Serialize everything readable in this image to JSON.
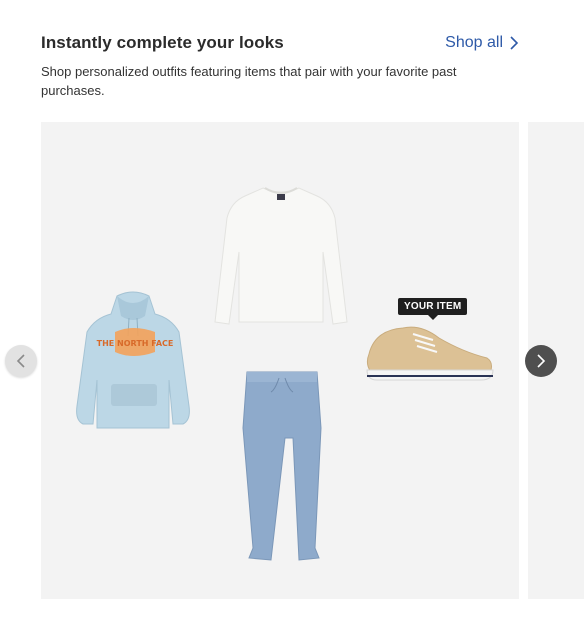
{
  "header": {
    "title": "Instantly complete your looks",
    "shop_all_label": "Shop all",
    "subtitle": "Shop personalized outfits featuring items that pair with your favorite past purchases."
  },
  "carousel": {
    "badge": "YOUR ITEM",
    "hoodie_text": "THE NORTH FACE",
    "items": [
      "hoodie-image",
      "shirt-image",
      "pants-image",
      "shoe-image"
    ]
  },
  "colors": {
    "link": "#2e5aa8",
    "card_bg": "#f3f3f3",
    "next_button": "#4f4f4f",
    "prev_button": "#e2e2e2"
  },
  "icons": {
    "shop_all": "chevron-right-icon",
    "prev": "chevron-left-icon",
    "next": "chevron-right-icon"
  }
}
